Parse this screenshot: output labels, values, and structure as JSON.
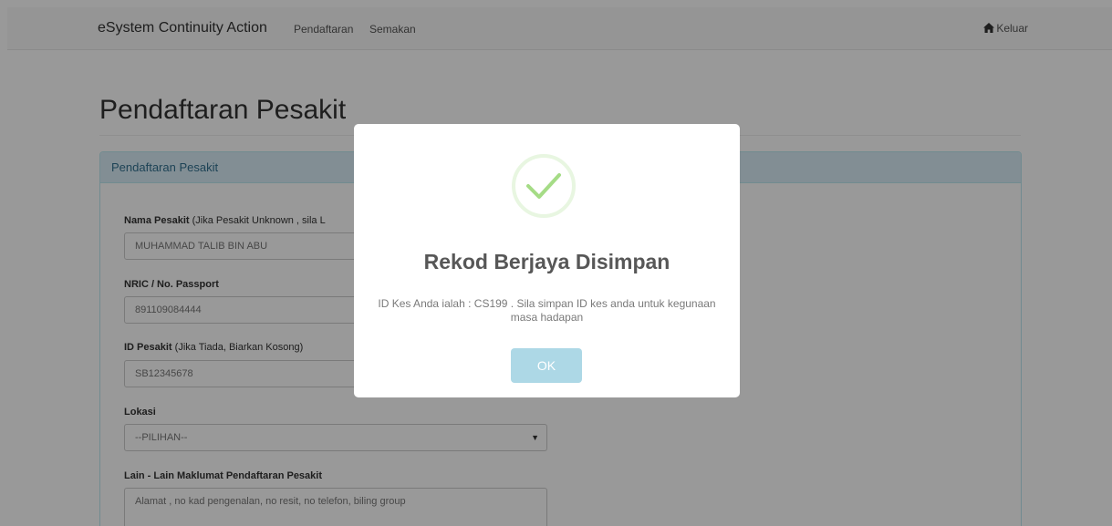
{
  "navbar": {
    "brand": "eSystem Continuity Action",
    "links": [
      "Pendaftaran",
      "Semakan"
    ],
    "logout_label": "Keluar"
  },
  "page": {
    "title": "Pendaftaran Pesakit"
  },
  "panel": {
    "heading": "Pendaftaran Pesakit",
    "fields": [
      {
        "label": "Nama Pesakit",
        "note": "(Jika Pesakit Unknown , sila L",
        "value": "MUHAMMAD TALIB BIN ABU"
      },
      {
        "label": "NRIC / No. Passport",
        "note": "",
        "value": "891109084444"
      },
      {
        "label": "ID Pesakit",
        "note": "(Jika Tiada, Biarkan Kosong)",
        "value": "SB12345678"
      },
      {
        "label": "Lokasi",
        "note": "",
        "value": "--PILIHAN--"
      },
      {
        "label": "Lain - Lain Maklumat Pendaftaran Pesakit",
        "note": "",
        "placeholder": "Alamat , no kad pengenalan, no resit, no telefon, biling group"
      }
    ]
  },
  "modal": {
    "icon": "check-icon",
    "title": "Rekod Berjaya Disimpan",
    "message": "ID Kes Anda ialah : CS199 . Sila simpan ID kes anda untuk kegunaan masa hadapan",
    "ok_label": "OK"
  },
  "colors": {
    "panel_heading_bg": "#d9edf7",
    "panel_heading_text": "#31708f",
    "success_check": "#a5dc86",
    "ok_button": "#add8e6"
  }
}
